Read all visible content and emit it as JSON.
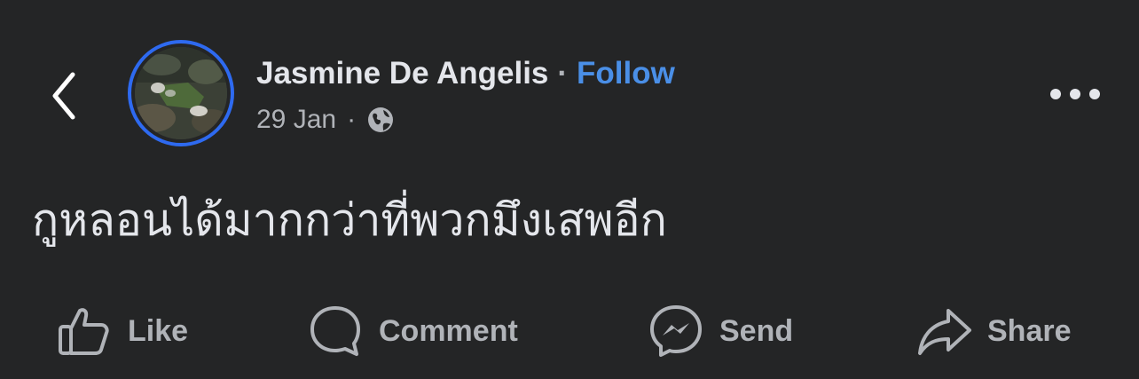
{
  "post": {
    "author": "Jasmine De Angelis",
    "separator": "·",
    "follow_label": "Follow",
    "date": "29 Jan",
    "meta_separator": "·",
    "audience_icon": "globe-icon",
    "text": "กูหลอนได้มากกว่าที่พวกมึงเสพอีก"
  },
  "actions": {
    "like_label": "Like",
    "comment_label": "Comment",
    "send_label": "Send",
    "share_label": "Share"
  },
  "icons": {
    "back": "back-chevron-icon",
    "more": "more-options-icon",
    "like": "thumbs-up-icon",
    "comment": "speech-bubble-icon",
    "send": "messenger-icon",
    "share": "share-arrow-icon"
  },
  "colors": {
    "background": "#242526",
    "primary_text": "#e4e6eb",
    "secondary_text": "#b0b3b8",
    "follow_link": "#4a8fe7",
    "avatar_ring": "#2e6af0"
  }
}
